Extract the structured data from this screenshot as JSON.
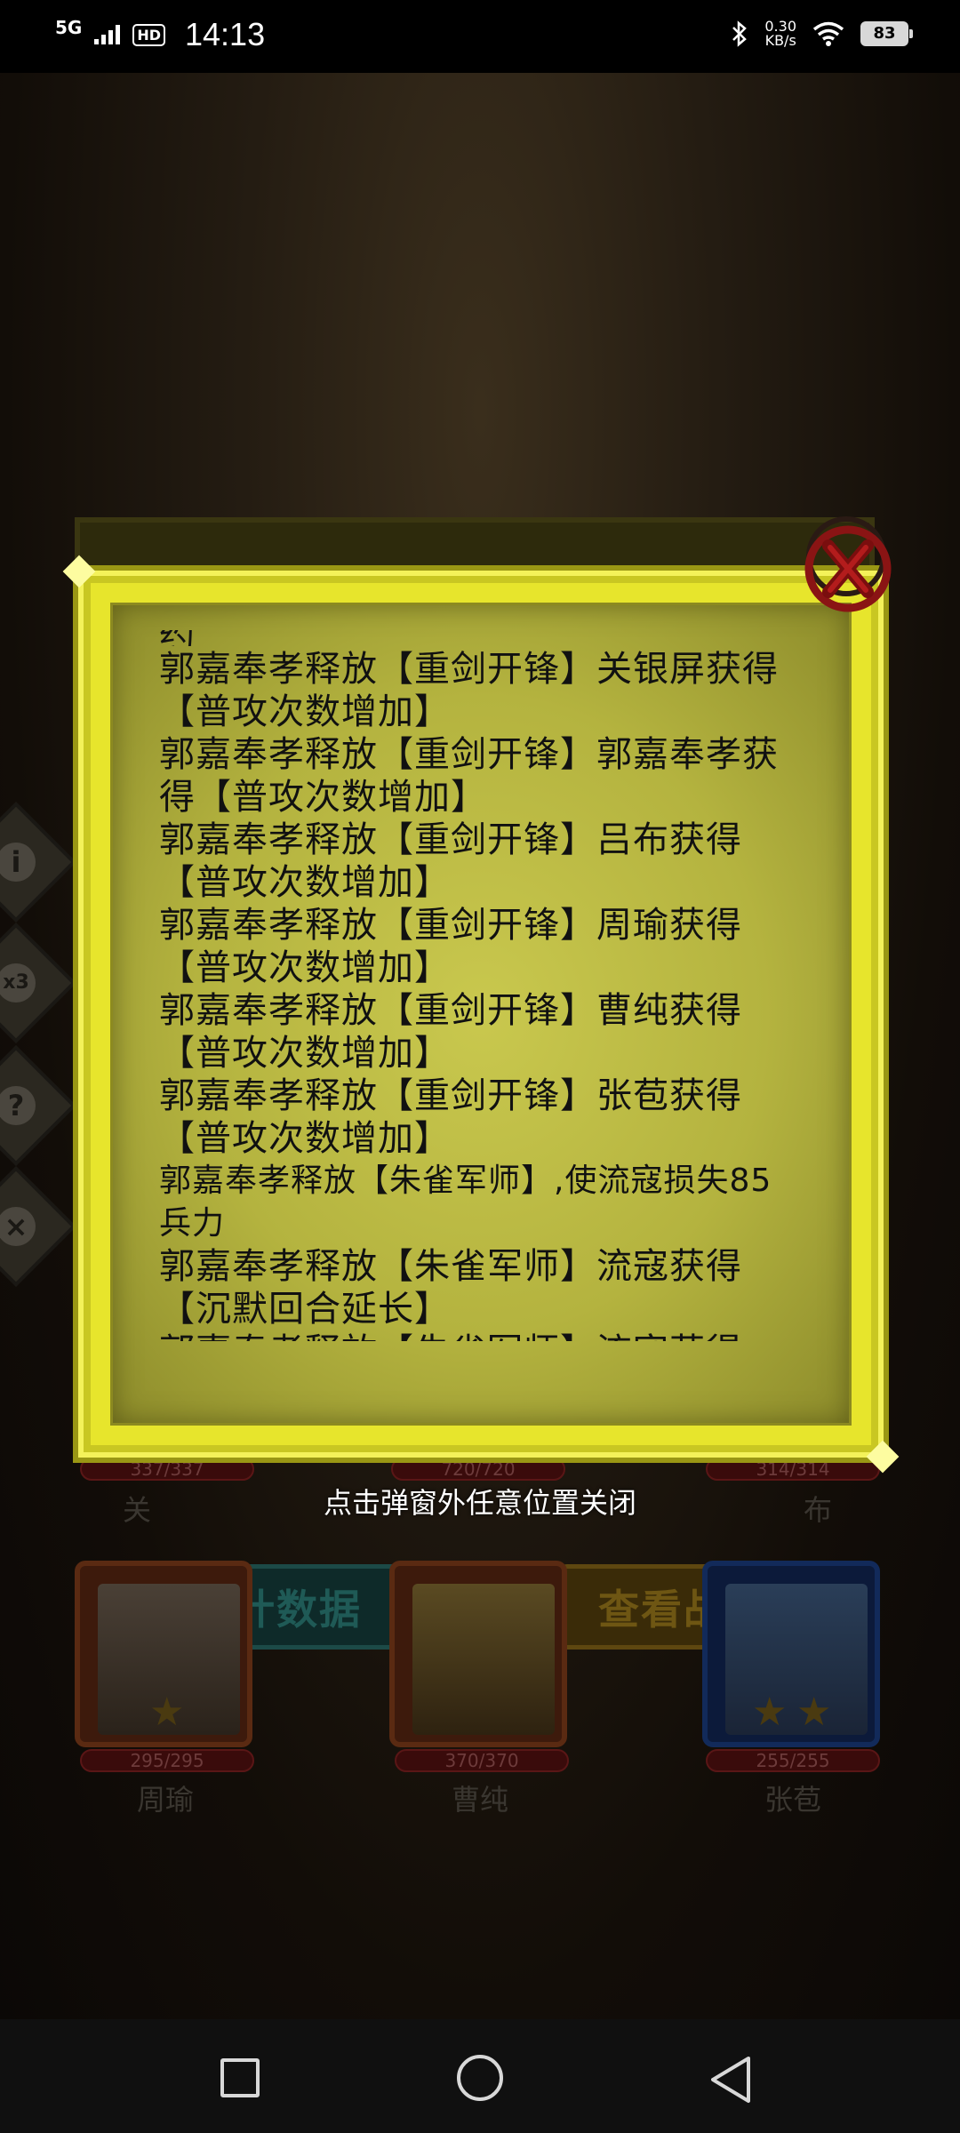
{
  "status_bar": {
    "network": "5G",
    "hd_badge": "HD",
    "time": "14:13",
    "speed_value": "0.30",
    "speed_unit": "KB/s",
    "battery": "83"
  },
  "battle_log": {
    "partial_top_line": "约",
    "entries": [
      "郭嘉奉孝释放【重剑开锋】关银屏获得【普攻次数增加】",
      "郭嘉奉孝释放【重剑开锋】郭嘉奉孝获得【普攻次数增加】",
      "郭嘉奉孝释放【重剑开锋】吕布获得【普攻次数增加】",
      "郭嘉奉孝释放【重剑开锋】周瑜获得【普攻次数增加】",
      "郭嘉奉孝释放【重剑开锋】曹纯获得【普攻次数增加】",
      "郭嘉奉孝释放【重剑开锋】张苞获得【普攻次数增加】",
      "郭嘉奉孝释放【朱雀军师】,使流寇损失85兵力",
      "郭嘉奉孝释放【朱雀军师】流寇获得【沉默回合延长】",
      "郭嘉奉孝释放【朱雀军师】流寇获得"
    ]
  },
  "close_hint": "点击弹窗外任意位置关闭",
  "background_buttons": {
    "stats": "统计数据",
    "report": "查看战报"
  },
  "heroes_row1": {
    "left": {
      "name": "关",
      "hp": "337/337"
    },
    "middle": {
      "hp": "720/720"
    },
    "right": {
      "name": "布",
      "hp": "314/314"
    }
  },
  "heroes_row2": [
    {
      "name": "周瑜",
      "hp": "295/295"
    },
    {
      "name": "曹纯",
      "hp": "370/370"
    },
    {
      "name": "张苞",
      "hp": "255/255"
    }
  ],
  "side_buttons": [
    "i",
    "x3",
    "?",
    "×"
  ],
  "icons": {
    "close": "close-x-icon",
    "nav_recent": "square-icon",
    "nav_home": "circle-icon",
    "nav_back": "triangle-back-icon"
  }
}
